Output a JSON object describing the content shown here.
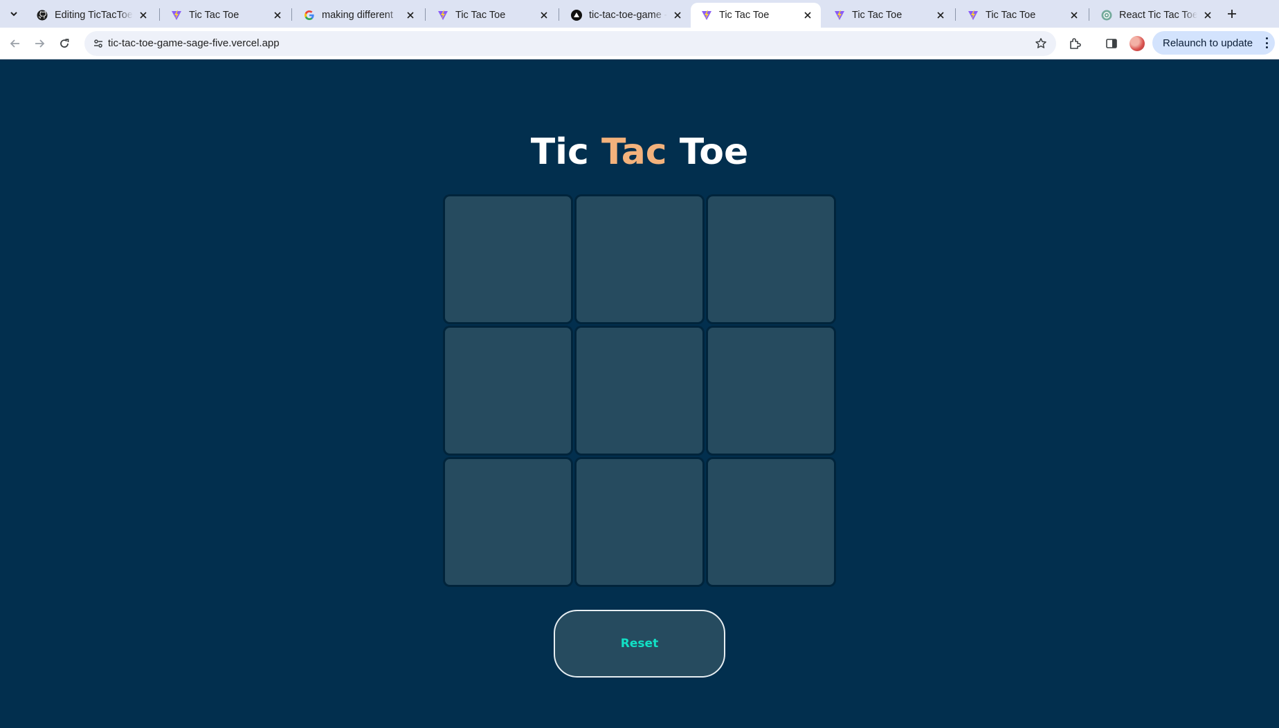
{
  "browser": {
    "tabs": [
      {
        "title": "Editing TicTacToe",
        "icon": "github-icon",
        "active": false
      },
      {
        "title": "Tic Tac Toe",
        "icon": "vite-icon",
        "active": false
      },
      {
        "title": "making different",
        "icon": "google-icon",
        "active": false
      },
      {
        "title": "Tic Tac Toe",
        "icon": "vite-icon",
        "active": false
      },
      {
        "title": "tic-tac-toe-game -",
        "icon": "vercel-icon",
        "active": false
      },
      {
        "title": "Tic Tac Toe",
        "icon": "vite-icon",
        "active": true
      },
      {
        "title": "Tic Tac Toe",
        "icon": "vite-icon",
        "active": false
      },
      {
        "title": "Tic Tac Toe",
        "icon": "vite-icon",
        "active": false
      },
      {
        "title": "React Tic Tac Toe",
        "icon": "chatgpt-icon",
        "active": false
      }
    ],
    "url": "tic-tac-toe-game-sage-five.vercel.app",
    "relaunch_label": "Relaunch to update"
  },
  "game": {
    "title_part1": "Tic ",
    "title_accent": "Tac",
    "title_part2": " Toe",
    "cells": [
      "",
      "",
      "",
      "",
      "",
      "",
      "",
      "",
      ""
    ],
    "reset_label": "Reset"
  },
  "colors": {
    "page_background": "#022f4e",
    "cell": "#264b5f",
    "title_accent": "#f3b27c",
    "reset_text": "#11e0c5"
  }
}
